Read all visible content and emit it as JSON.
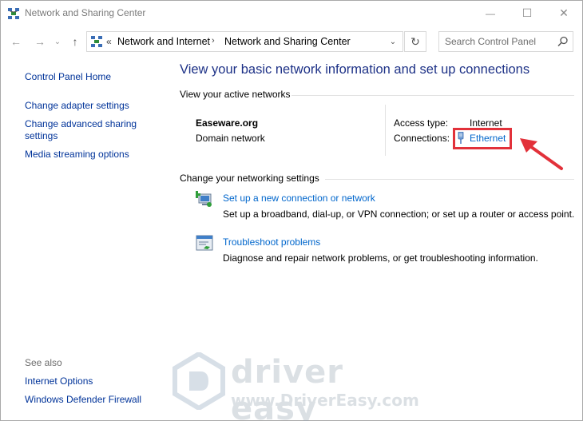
{
  "window": {
    "title": "Network and Sharing Center",
    "minimize_glyph": "—",
    "maximize_glyph": "☐",
    "close_glyph": "✕"
  },
  "nav": {
    "back_glyph": "←",
    "forward_glyph": "→",
    "recent_glyph": "⌄",
    "up_glyph": "↑",
    "breadcrumb_sep0": "«",
    "breadcrumb": [
      "Network and Internet",
      "Network and Sharing Center"
    ],
    "breadcrumb_sep": "›",
    "address_dropdown_glyph": "⌄",
    "refresh_glyph": "↻",
    "search_placeholder": "Search Control Panel"
  },
  "sidebar": {
    "home": "Control Panel Home",
    "links": [
      "Change adapter settings",
      "Change advanced sharing settings",
      "Media streaming options"
    ],
    "see_also_heading": "See also",
    "see_also": [
      "Internet Options",
      "Windows Defender Firewall"
    ]
  },
  "main": {
    "title": "View your basic network information and set up connections",
    "active_heading": "View your active networks",
    "network": {
      "name": "Easeware.org",
      "type": "Domain network",
      "access_label": "Access type:",
      "access_value": "Internet",
      "connections_label": "Connections:",
      "connection_link": "Ethernet"
    },
    "change_heading": "Change your networking settings",
    "tasks": [
      {
        "icon": "network-setup-icon",
        "link": "Set up a new connection or network",
        "desc": "Set up a broadband, dial-up, or VPN connection; or set up a router or access point."
      },
      {
        "icon": "troubleshoot-icon",
        "link": "Troubleshoot problems",
        "desc": "Diagnose and repair network problems, or get troubleshooting information."
      }
    ]
  },
  "watermark": {
    "brand": "driver easy",
    "url": "www.DriverEasy.com"
  },
  "colors": {
    "link": "#0066cc",
    "sidebar_link": "#003399",
    "title": "#1e3287",
    "highlight": "#e2313a"
  }
}
